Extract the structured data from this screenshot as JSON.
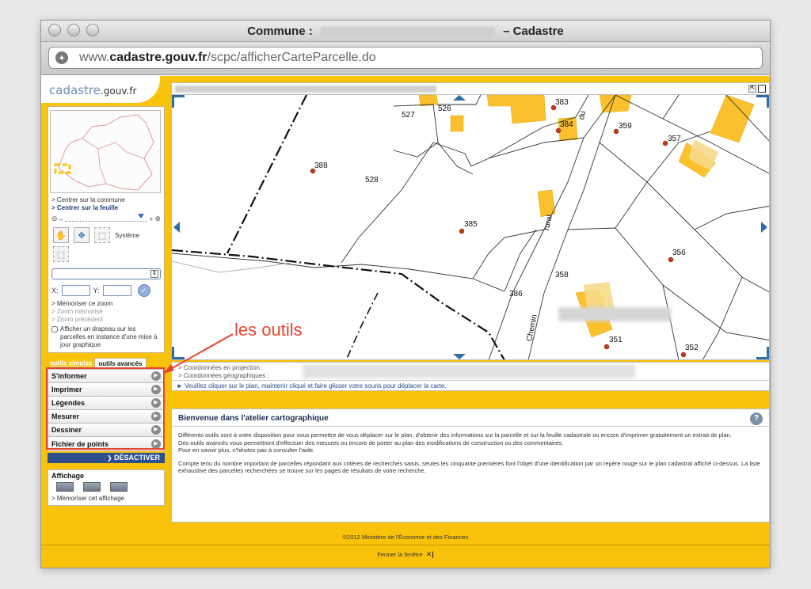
{
  "window": {
    "title_prefix": "Commune :",
    "title_suffix": "– Cadastre",
    "url_host": "www.",
    "url_domain": "cadastre.gouv.fr",
    "url_path": "/scpc/afficherCarteParcelle.do"
  },
  "logo": {
    "main": "cadastre",
    "tld": ".gouv.fr"
  },
  "sidebar": {
    "links": {
      "center_commune": "> Centrer sur la commune",
      "center_sheet": "> Centrer sur la feuille",
      "memorize_zoom": "> Mémoriser ce zoom",
      "memorized_zoom": "> Zoom mémorisé",
      "previous_zoom": "> Zoom précédent",
      "flag_checkbox": "Afficher un drapeau sur les parcelles en instance d'une mise à jour graphique"
    },
    "system_label": "Système",
    "x_label": "X:",
    "y_label": "Y:",
    "tabs": {
      "simple": "outils simples",
      "advanced": "outils avancés"
    },
    "tools": [
      "S'informer",
      "Imprimer",
      "Légendes",
      "Mesurer",
      "Dessiner",
      "Fichier de points"
    ],
    "deactivate": "DÉSACTIVER",
    "affichage": {
      "title": "Affichage",
      "memorize": "> Mémoriser cet affichage"
    }
  },
  "annotation": "les outils",
  "map": {
    "parcels": [
      {
        "label": "527"
      },
      {
        "label": "526"
      },
      {
        "label": "383"
      },
      {
        "label": "384"
      },
      {
        "label": "359"
      },
      {
        "label": "357"
      },
      {
        "label": "388"
      },
      {
        "label": "528"
      },
      {
        "label": "385"
      },
      {
        "label": "356"
      },
      {
        "label": "358"
      },
      {
        "label": "386"
      },
      {
        "label": "351"
      },
      {
        "label": "352"
      }
    ],
    "road_rural": "rural",
    "road_chemin": "Chemin",
    "road_du": "du"
  },
  "coordinates": {
    "projection": "> Coordonnées en projection :",
    "geographic": "> Coordonnées géographiques :",
    "hint": "► Veuillez cliquer sur le plan, maintenir cliqué et faire glisser votre souris pour déplacer la carte."
  },
  "welcome": {
    "title": "Bienvenue dans l'atelier cartographique",
    "p1": "Différents outils sont à votre disposition pour vous permettre de vous déplacer sur le plan, d'obtenir des informations sur la parcelle et sur la feuille cadastrale ou encore d'imprimer gratuitement un extrait de plan.",
    "p2": "Des outils avancés vous permettront d'effectuer des mesures ou encore de porter au plan des modifications de construction ou des commentaires.",
    "p3": "Pour en savoir plus, n'hésitez pas à consulter l'aide.",
    "p4": "Compte tenu du nombre important de parcelles répondant aux critères de recherches saisis, seules les cinquante premières font l'objet d'une identification par un repère rouge sur le plan cadastral affiché ci-dessus. La liste exhaustive des parcelles recherchées se trouve sur les pages de résultats de votre recherche."
  },
  "footer": {
    "copyright": "©2012 Ministère de l'Économie et des Finances",
    "close": "Fermer la fenêtre"
  },
  "colors": {
    "accent": "#f9c20b",
    "building": "#fbc02d",
    "link": "#2d4f8e",
    "annotation": "#e8442e"
  }
}
